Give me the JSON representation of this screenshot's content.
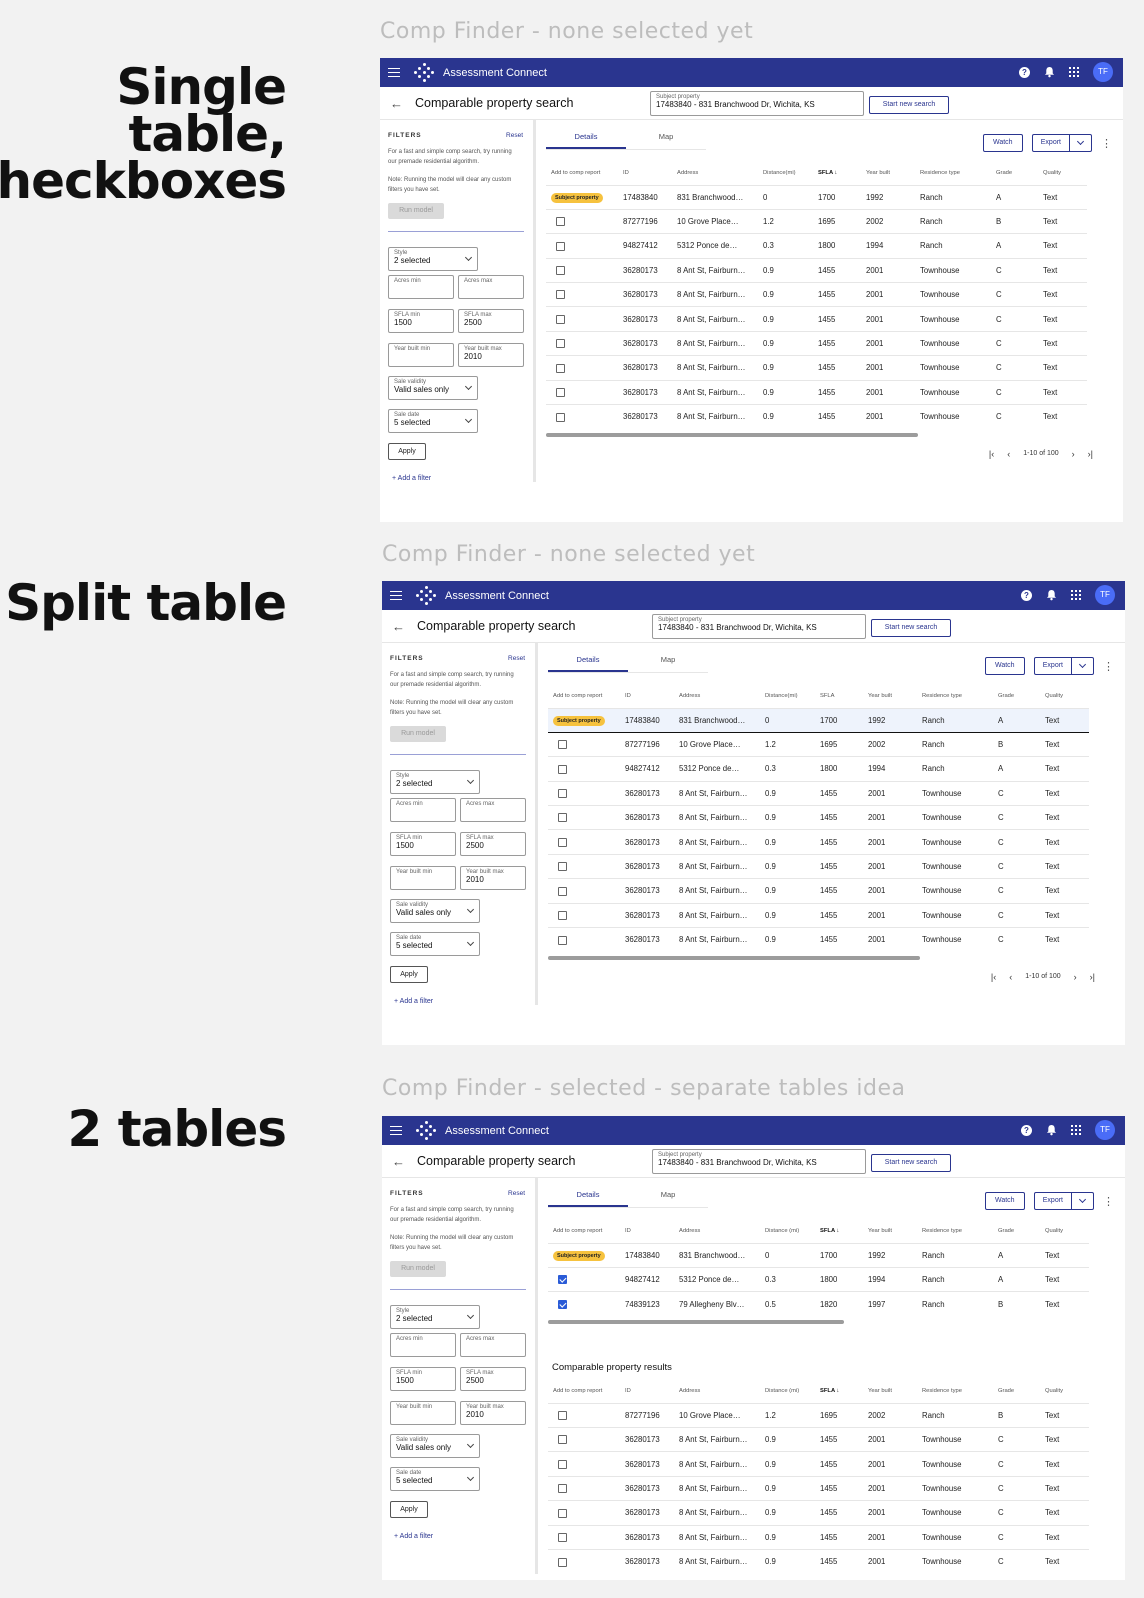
{
  "sections": [
    {
      "label": "Single table, checkboxes"
    },
    {
      "label": "Split table"
    },
    {
      "label": "2 tables"
    }
  ],
  "frames": [
    {
      "caption": "Comp Finder - none selected yet"
    },
    {
      "caption": "Comp Finder - none selected yet"
    },
    {
      "caption": "Comp Finder - selected - separate tables idea"
    }
  ],
  "app": {
    "title": "Assessment Connect",
    "avatar": "TF"
  },
  "page": {
    "title": "Comparable property search",
    "subject_label": "Subject property",
    "subject_value": "17483840 - 831 Branchwood Dr, Wichita, KS",
    "start_new_label": "Start new search"
  },
  "filters": {
    "title": "FILTERS",
    "reset": "Reset",
    "help1": "For a fast and simple comp search, try running our premade residential algorithm.",
    "help2": "Note: Running the model will clear any custom filters you have set.",
    "run_model": "Run model",
    "style_label": "Style",
    "style_value": "2 selected",
    "acres_min": "Acres min",
    "acres_max": "Acres max",
    "sfla_min_label": "SFLA min",
    "sfla_min_value": "1500",
    "sfla_max_label": "SFLA max",
    "sfla_max_value": "2500",
    "yb_min": "Year built min",
    "yb_max_label": "Year built max",
    "yb_max_value": "2010",
    "validity_label": "Sale validity",
    "validity_value": "Valid sales only",
    "date_label": "Sale date",
    "date_value": "5 selected",
    "apply": "Apply",
    "add_filter": "+ Add a filter"
  },
  "tabs": {
    "details": "Details",
    "map": "Map"
  },
  "toolbar": {
    "watch": "Watch",
    "export": "Export"
  },
  "columns": {
    "add": "Add to comp report",
    "id": "ID",
    "address": "Address",
    "dist1": "Distance(mi)",
    "dist2": "Distance (mi)",
    "sfla": "SFLA",
    "year": "Year built",
    "res": "Residence type",
    "grade": "Grade",
    "quality": "Quality"
  },
  "subject_badge": "Subject property",
  "pager": {
    "range": "1-10 of 100"
  },
  "results_title": "Comparable property results",
  "rows": {
    "subject": {
      "id": "17483840",
      "address": "831 Branchwood…",
      "dist": "0",
      "sfla": "1700",
      "year": "1992",
      "res": "Ranch",
      "grade": "A",
      "quality": "Text"
    },
    "grove": {
      "id": "87277196",
      "address": "10 Grove Place…",
      "dist": "1.2",
      "sfla": "1695",
      "year": "2002",
      "res": "Ranch",
      "grade": "B",
      "quality": "Text"
    },
    "ponce": {
      "id": "94827412",
      "address": "5312 Ponce de…",
      "dist": "0.3",
      "sfla": "1800",
      "year": "1994",
      "res": "Ranch",
      "grade": "A",
      "quality": "Text"
    },
    "ant": {
      "id": "36280173",
      "address": "8 Ant St, Fairburn…",
      "dist": "0.9",
      "sfla": "1455",
      "year": "2001",
      "res": "Townhouse",
      "grade": "C",
      "quality": "Text"
    },
    "allegheny": {
      "id": "74839123",
      "address": "79 Allegheny Blv…",
      "dist": "0.5",
      "sfla": "1820",
      "year": "1997",
      "res": "Ranch",
      "grade": "B",
      "quality": "Text"
    }
  }
}
